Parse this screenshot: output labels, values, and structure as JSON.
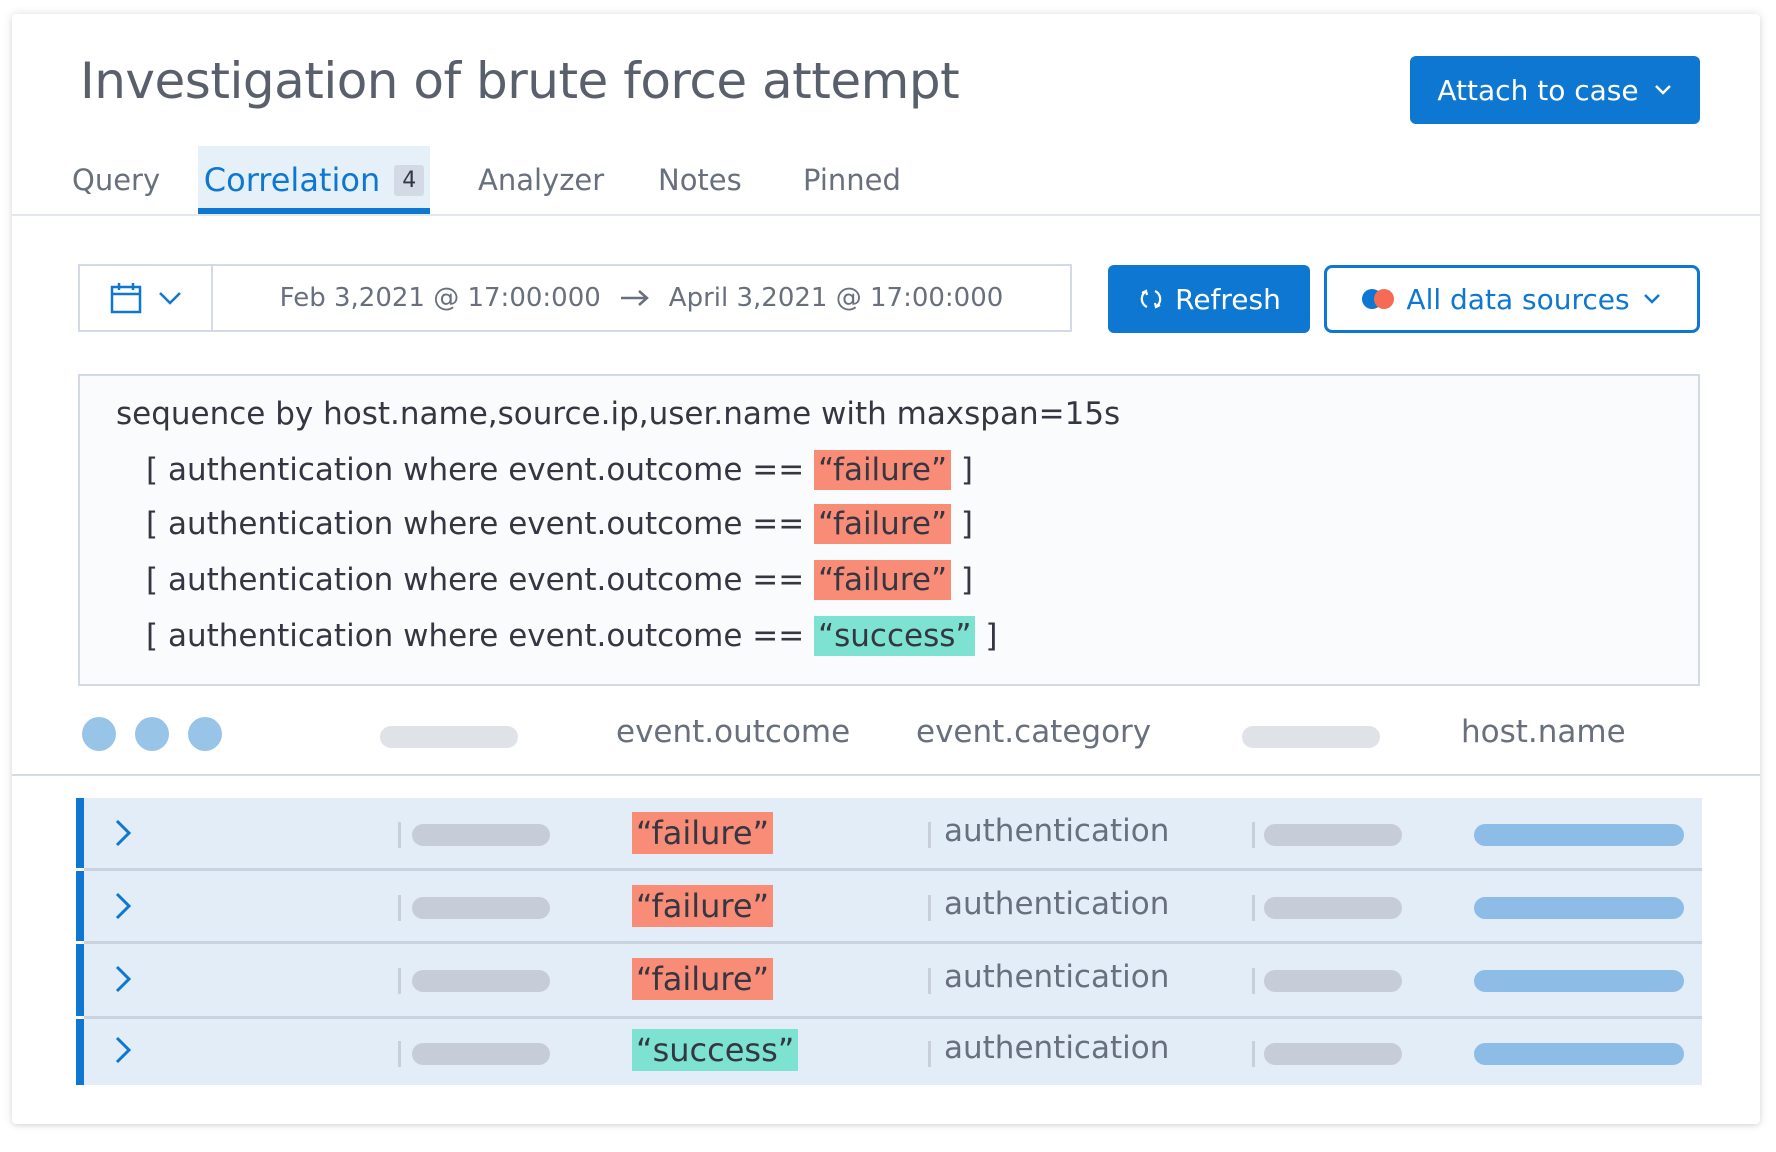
{
  "header": {
    "title": "Investigation of brute force attempt",
    "attach_label": "Attach to case"
  },
  "tabs": [
    {
      "label": "Query"
    },
    {
      "label": "Correlation",
      "count": "4"
    },
    {
      "label": "Analyzer"
    },
    {
      "label": "Notes"
    },
    {
      "label": "Pinned"
    }
  ],
  "active_tab": "Correlation",
  "date_range": {
    "start": "Feb 3,2021 @ 17:00:000",
    "end": "April 3,2021 @ 17:00:000"
  },
  "toolbar": {
    "refresh_label": "Refresh",
    "sources_label": "All data sources"
  },
  "query": {
    "line1": "sequence by host.name,source.ip,user.name with maxspan=15s",
    "conditions": [
      {
        "prefix": "[ authentication where event.outcome == ",
        "value": "“failure”",
        "suffix": " ]",
        "status": "failure"
      },
      {
        "prefix": "[ authentication where event.outcome == ",
        "value": "“failure”",
        "suffix": " ]",
        "status": "failure"
      },
      {
        "prefix": "[ authentication where event.outcome == ",
        "value": "“failure”",
        "suffix": " ]",
        "status": "failure"
      },
      {
        "prefix": "[ authentication where event.outcome == ",
        "value": "“success”",
        "suffix": " ]",
        "status": "success"
      }
    ]
  },
  "columns": {
    "outcome": "event.outcome",
    "category": "event.category",
    "host": "host.name"
  },
  "rows": [
    {
      "outcome": "“failure”",
      "status": "failure",
      "category": "authentication"
    },
    {
      "outcome": "“failure”",
      "status": "failure",
      "category": "authentication"
    },
    {
      "outcome": "“failure”",
      "status": "failure",
      "category": "authentication"
    },
    {
      "outcome": "“success”",
      "status": "success",
      "category": "authentication"
    }
  ],
  "colors": {
    "accent": "#0e77d2",
    "failure": "#f98c77",
    "success": "#7de2d1",
    "row_bg": "#e2edf7"
  }
}
